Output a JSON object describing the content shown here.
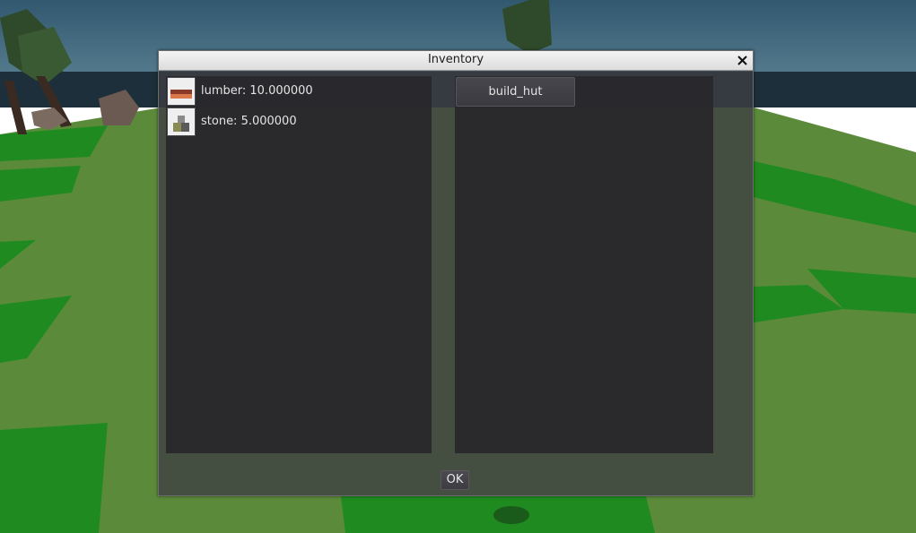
{
  "window": {
    "title": "Inventory"
  },
  "inventory": {
    "items": [
      {
        "label": "lumber: 10.000000",
        "icon": "lumber-icon"
      },
      {
        "label": "stone: 5.000000",
        "icon": "stone-icon"
      }
    ]
  },
  "recipes": {
    "buttons": [
      {
        "label": "build_hut"
      }
    ]
  },
  "footer": {
    "ok_label": "OK"
  },
  "colors": {
    "sky": "#3a5f7c",
    "grass_dark": "#1f8a1f",
    "grass_light": "#5f8a3a",
    "panel": "#28282c",
    "title_bar": "#e6e6e6"
  }
}
